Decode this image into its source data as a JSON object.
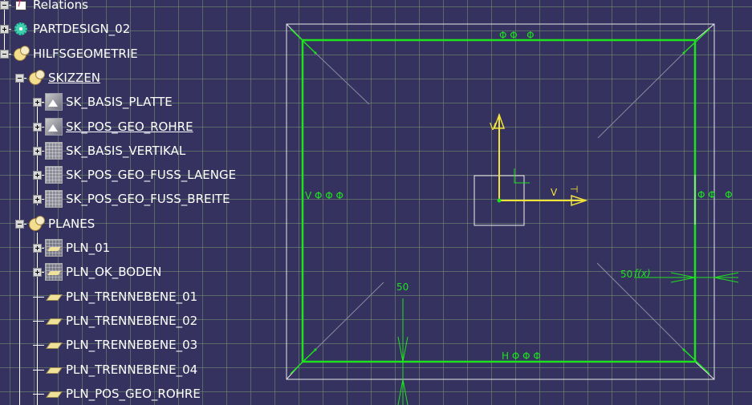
{
  "tree": {
    "items": [
      {
        "label": "Relations",
        "icon": "relations-icon",
        "expander": "minus",
        "underlined": false
      },
      {
        "label": "PARTDESIGN_02",
        "icon": "part-body-icon",
        "expander": "plus",
        "underlined": false
      },
      {
        "label": "HILFSGEOMETRIE",
        "icon": "geometrical-set-icon",
        "expander": "minus",
        "underlined": false
      },
      {
        "label": "SKIZZEN",
        "icon": "geometrical-set-icon",
        "expander": "minus",
        "underlined": true
      },
      {
        "label": "SK_BASIS_PLATTE",
        "icon": "sketch-icon",
        "expander": "plus",
        "underlined": false
      },
      {
        "label": "SK_POS_GEO_ROHRE",
        "icon": "sketch-icon",
        "expander": "plus",
        "underlined": true
      },
      {
        "label": "SK_BASIS_VERTIKAL",
        "icon": "sketch-hidden-icon",
        "expander": "plus",
        "underlined": false
      },
      {
        "label": "SK_POS_GEO_FUSS_LAENGE",
        "icon": "sketch-hidden-icon",
        "expander": "plus",
        "underlined": false
      },
      {
        "label": "SK_POS_GEO_FUSS_BREITE",
        "icon": "sketch-hidden-icon",
        "expander": "plus",
        "underlined": false
      },
      {
        "label": "PLANES",
        "icon": "geometrical-set-icon",
        "expander": "minus",
        "underlined": false
      },
      {
        "label": "PLN_01",
        "icon": "plane-hidden-icon",
        "expander": "plus",
        "underlined": false
      },
      {
        "label": "PLN_OK_BODEN",
        "icon": "plane-hidden-icon",
        "expander": "plus",
        "underlined": false
      },
      {
        "label": "PLN_TRENNEBENE_01",
        "icon": "plane-icon",
        "expander": "none",
        "underlined": false
      },
      {
        "label": "PLN_TRENNEBENE_02",
        "icon": "plane-icon",
        "expander": "none",
        "underlined": false
      },
      {
        "label": "PLN_TRENNEBENE_03",
        "icon": "plane-icon",
        "expander": "none",
        "underlined": false
      },
      {
        "label": "PLN_TRENNEBENE_04",
        "icon": "plane-icon",
        "expander": "none",
        "underlined": false
      },
      {
        "label": "PLN_POS_GEO_ROHRE",
        "icon": "plane-icon",
        "expander": "none",
        "underlined": false
      }
    ]
  },
  "viewport": {
    "background_color": "#35325f",
    "geometry_color": "#1de21d",
    "axis_color": "#f2e23a",
    "axis_labels": {
      "v_vertical": "V",
      "h_horizontal": "V",
      "tick": "⊣"
    },
    "constraints": {
      "top": "Φ Φ   Φ",
      "left": "V Φ Φ Φ",
      "right": "Φ Φ   Φ",
      "bottom": "H Φ Φ Φ"
    },
    "dimensions": {
      "vertical_dim": "50",
      "horizontal_dim": "50",
      "horizontal_dim_suffix": "f(x)"
    }
  }
}
